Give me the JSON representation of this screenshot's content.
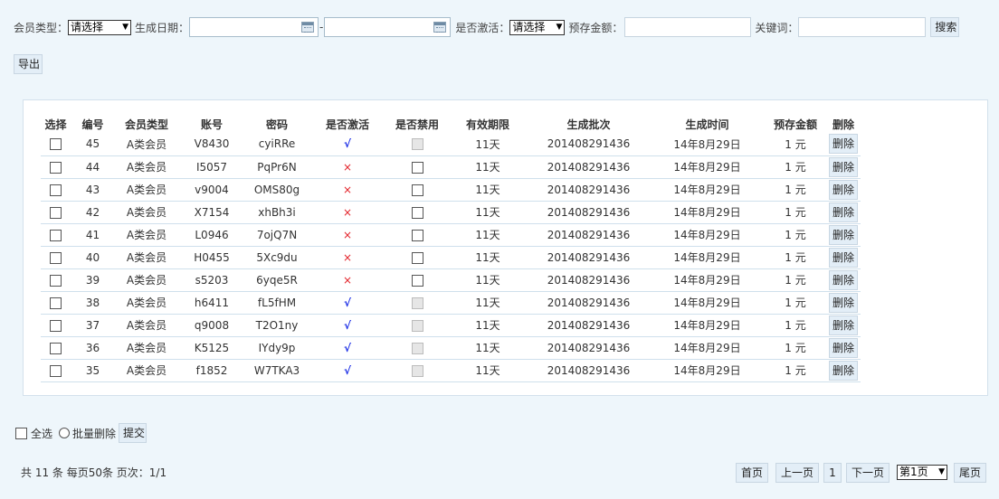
{
  "filters": {
    "member_type_label": "会员类型：",
    "member_type_value": "请选择",
    "gen_date_label": "生成日期：",
    "date_separator": "-",
    "activated_label": "是否激活：",
    "activated_value": "请选择",
    "deposit_label": "预存金额：",
    "keyword_label": "关键词：",
    "search_button": "搜索"
  },
  "export_button": "导出",
  "table": {
    "headers": [
      "选择",
      "编号",
      "会员类型",
      "账号",
      "密码",
      "是否激活",
      "是否禁用",
      "有效期限",
      "生成批次",
      "生成时间",
      "预存金额",
      "删除"
    ],
    "rows": [
      {
        "id": "45",
        "type": "A类会员",
        "account": "V8430",
        "password": "cyiRRe",
        "activated": "√",
        "activated_state": "yes",
        "disabled": "locked",
        "validity": "11天",
        "batch": "201408291436",
        "time": "14年8月29日",
        "amount": "1 元",
        "delete": "删除"
      },
      {
        "id": "44",
        "type": "A类会员",
        "account": "I5057",
        "password": "PqPr6N",
        "activated": "×",
        "activated_state": "no",
        "disabled": "open",
        "validity": "11天",
        "batch": "201408291436",
        "time": "14年8月29日",
        "amount": "1 元",
        "delete": "删除"
      },
      {
        "id": "43",
        "type": "A类会员",
        "account": "v9004",
        "password": "OMS80g",
        "activated": "×",
        "activated_state": "no",
        "disabled": "open",
        "validity": "11天",
        "batch": "201408291436",
        "time": "14年8月29日",
        "amount": "1 元",
        "delete": "删除"
      },
      {
        "id": "42",
        "type": "A类会员",
        "account": "X7154",
        "password": "xhBh3i",
        "activated": "×",
        "activated_state": "no",
        "disabled": "open",
        "validity": "11天",
        "batch": "201408291436",
        "time": "14年8月29日",
        "amount": "1 元",
        "delete": "删除"
      },
      {
        "id": "41",
        "type": "A类会员",
        "account": "L0946",
        "password": "7ojQ7N",
        "activated": "×",
        "activated_state": "no",
        "disabled": "open",
        "validity": "11天",
        "batch": "201408291436",
        "time": "14年8月29日",
        "amount": "1 元",
        "delete": "删除"
      },
      {
        "id": "40",
        "type": "A类会员",
        "account": "H0455",
        "password": "5Xc9du",
        "activated": "×",
        "activated_state": "no",
        "disabled": "open",
        "validity": "11天",
        "batch": "201408291436",
        "time": "14年8月29日",
        "amount": "1 元",
        "delete": "删除"
      },
      {
        "id": "39",
        "type": "A类会员",
        "account": "s5203",
        "password": "6yqe5R",
        "activated": "×",
        "activated_state": "no",
        "disabled": "open",
        "validity": "11天",
        "batch": "201408291436",
        "time": "14年8月29日",
        "amount": "1 元",
        "delete": "删除"
      },
      {
        "id": "38",
        "type": "A类会员",
        "account": "h6411",
        "password": "fL5fHM",
        "activated": "√",
        "activated_state": "yes",
        "disabled": "locked",
        "validity": "11天",
        "batch": "201408291436",
        "time": "14年8月29日",
        "amount": "1 元",
        "delete": "删除"
      },
      {
        "id": "37",
        "type": "A类会员",
        "account": "q9008",
        "password": "T2O1ny",
        "activated": "√",
        "activated_state": "yes",
        "disabled": "locked",
        "validity": "11天",
        "batch": "201408291436",
        "time": "14年8月29日",
        "amount": "1 元",
        "delete": "删除"
      },
      {
        "id": "36",
        "type": "A类会员",
        "account": "K5125",
        "password": "IYdy9p",
        "activated": "√",
        "activated_state": "yes",
        "disabled": "locked",
        "validity": "11天",
        "batch": "201408291436",
        "time": "14年8月29日",
        "amount": "1 元",
        "delete": "删除"
      },
      {
        "id": "35",
        "type": "A类会员",
        "account": "f1852",
        "password": "W7TKA3",
        "activated": "√",
        "activated_state": "yes",
        "disabled": "locked",
        "validity": "11天",
        "batch": "201408291436",
        "time": "14年8月29日",
        "amount": "1 元",
        "delete": "删除"
      }
    ]
  },
  "bottom": {
    "select_all": "全选",
    "batch_delete": "批量删除",
    "submit": "提交"
  },
  "pager": {
    "info": "共 11 条 每页50条 页次：1/1",
    "first": "首页",
    "prev": "上一页",
    "current": "1",
    "next": "下一页",
    "page_select": "第1页",
    "last": "尾页"
  },
  "colors": {
    "background": "#eef6fb",
    "activated_yes": "#1c2ee6",
    "activated_no": "#e3242b",
    "button_bg": "#e3eef7"
  }
}
